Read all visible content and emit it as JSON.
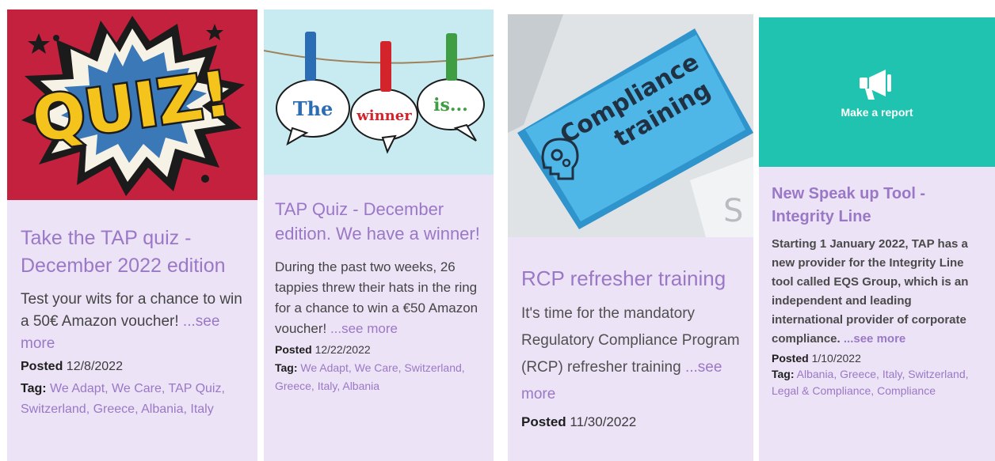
{
  "cards": [
    {
      "image_text": "QUIZ!",
      "title": "Take the TAP quiz - December 2022 edition",
      "description": "Test your wits for a chance to win a 50€ Amazon voucher!",
      "see_more": "...see more",
      "posted_label": "Posted",
      "posted_date": "12/8/2022",
      "tag_label": "Tag:",
      "tags": [
        "We Adapt",
        "We Care",
        "TAP Quiz",
        "Switzerland",
        "Greece",
        "Albania",
        "Italy"
      ]
    },
    {
      "image_words": [
        "The",
        "winner",
        "is..."
      ],
      "title": "TAP Quiz - December edition. We have a winner!",
      "description": "During the past two weeks, 26 tappies threw their hats in the ring for a chance to win a €50 Amazon voucher!",
      "see_more": "...see more",
      "posted_label": "Posted",
      "posted_date": "12/22/2022",
      "tag_label": "Tag:",
      "tags": [
        "We Adapt",
        "We Care",
        "Switzerland",
        "Greece",
        "Italy",
        "Albania"
      ]
    },
    {
      "image_text": [
        "Compliance",
        "training"
      ],
      "title": "RCP refresher training",
      "description": "It's time for the mandatory Regulatory Compliance Program (RCP) refresher training",
      "see_more": "...see more",
      "posted_label": "Posted",
      "posted_date": "11/30/2022"
    },
    {
      "banner_label": "Make a report",
      "banner_icon": "megaphone-icon",
      "title": "New Speak up Tool - Integrity Line",
      "description": "Starting 1 January 2022, TAP has a new provider for the Integrity Line tool called EQS Group, which is an independent and leading international provider of corporate compliance.",
      "see_more": "...see more",
      "posted_label": "Posted",
      "posted_date": "1/10/2022",
      "tag_label": "Tag:",
      "tags": [
        "Albania",
        "Greece",
        "Italy",
        "Switzerland",
        "Legal & Compliance",
        "Compliance"
      ]
    }
  ],
  "colors": {
    "card_body": "#ece3f6",
    "title_purple": "#9b78c6",
    "quiz_red": "#c3213d",
    "quiz_yellow": "#f5c41c",
    "compliance_blue": "#4fb6e8",
    "report_teal": "#1fc3b0"
  }
}
